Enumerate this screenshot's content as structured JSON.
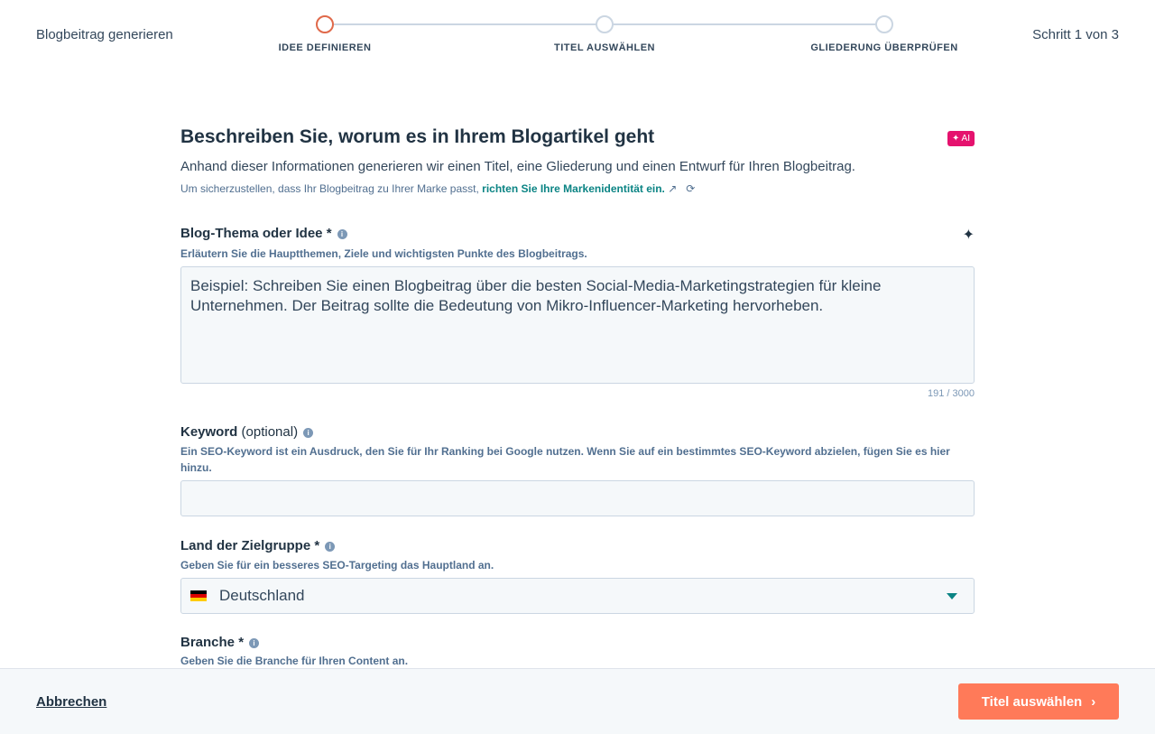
{
  "header": {
    "title": "Blogbeitrag generieren",
    "step_counter": "Schritt 1 von 3",
    "steps": [
      {
        "label": "IDEE DEFINIEREN",
        "active": true
      },
      {
        "label": "TITEL AUSWÄHLEN",
        "active": false
      },
      {
        "label": "GLIEDERUNG ÜBERPRÜFEN",
        "active": false
      }
    ]
  },
  "main": {
    "heading": "Beschreiben Sie, worum es in Ihrem Blogartikel geht",
    "ai_badge": "✦ AI",
    "description": "Anhand dieser Informationen generieren wir einen Titel, eine Gliederung und einen Entwurf für Ihren Blogbeitrag.",
    "brand_note": "Um sicherzustellen, dass Ihr Blogbeitrag zu Ihrer Marke passt,",
    "brand_link": "richten Sie Ihre Markenidentität ein.",
    "topic": {
      "label": "Blog-Thema oder Idee *",
      "help": "Erläutern Sie die Hauptthemen, Ziele und wichtigsten Punkte des Blogbeitrags.",
      "value": "Beispiel: Schreiben Sie einen Blogbeitrag über die besten Social-Media-Marketingstrategien für kleine Unternehmen. Der Beitrag sollte die Bedeutung von Mikro-Influencer-Marketing hervorheben.",
      "counter": "191 / 3000"
    },
    "keyword": {
      "label": "Keyword",
      "optional": "(optional)",
      "help": "Ein SEO-Keyword ist ein Ausdruck, den Sie für Ihr Ranking bei Google nutzen. Wenn Sie auf ein bestimmtes SEO-Keyword abzielen, fügen Sie es hier hinzu.",
      "value": ""
    },
    "country": {
      "label": "Land der Zielgruppe *",
      "help": "Geben Sie für ein besseres SEO-Targeting das Hauptland an.",
      "value": "Deutschland"
    },
    "industry": {
      "label": "Branche *",
      "help": "Geben Sie die Branche für Ihren Content an."
    }
  },
  "footer": {
    "cancel": "Abbrechen",
    "next": "Titel auswählen"
  },
  "colors": {
    "accent": "#ff7a59",
    "ai": "#e5126e",
    "link": "#0b8484"
  }
}
